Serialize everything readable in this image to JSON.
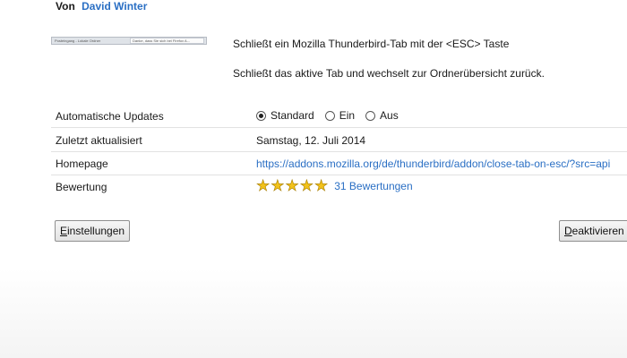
{
  "author": {
    "prefix": "Von",
    "name": "David Winter"
  },
  "screenshot_thumb": {
    "tab1": "Posteingang - Lokale Ordner",
    "tab2": "Danke, dass Sie sich bei Firefox A..."
  },
  "description": {
    "line1": "Schließt ein Mozilla Thunderbird-Tab mit der <ESC> Taste",
    "line2": "Schließt das aktive Tab und wechselt zur Ordnerübersicht zurück."
  },
  "details": {
    "updates": {
      "label": "Automatische Updates",
      "options": [
        "Standard",
        "Ein",
        "Aus"
      ],
      "selected": "Standard"
    },
    "last_updated": {
      "label": "Zuletzt aktualisiert",
      "value": "Samstag, 12. Juli 2014"
    },
    "homepage": {
      "label": "Homepage",
      "value": "https://addons.mozilla.org/de/thunderbird/addon/close-tab-on-esc/?src=api"
    },
    "rating": {
      "label": "Bewertung",
      "stars": 5,
      "count_text": "31 Bewertungen"
    }
  },
  "buttons": {
    "settings": "Einstellungen",
    "disable": "Deaktivieren"
  },
  "colors": {
    "link": "#2a6fc4",
    "star": "#f2c21a"
  }
}
